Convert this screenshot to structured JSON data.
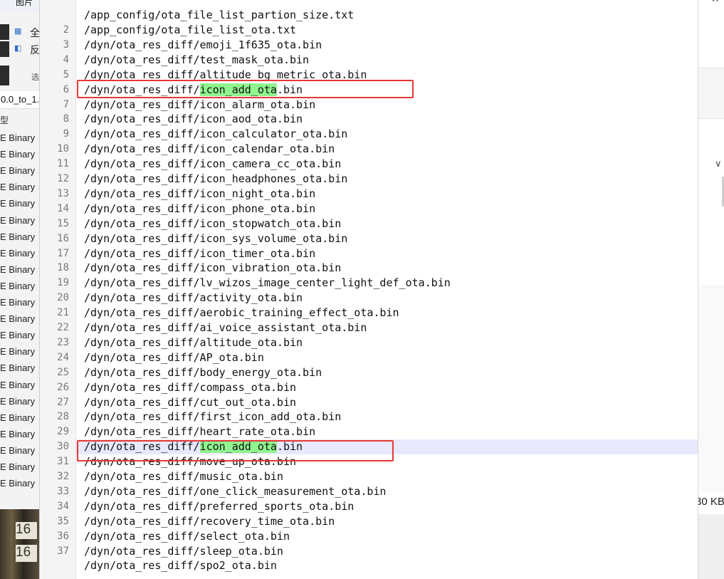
{
  "left_panel": {
    "title_fragment": "图片",
    "toolbar_items": [
      "全",
      "反"
    ],
    "nav_fragment": "选",
    "breadcrumb_fragment": "0.0_to_1.",
    "column_header_fragment": "型",
    "type_values": [
      "E Binary",
      "E Binary",
      "E Binary",
      "E Binary",
      "E Binary",
      "E Binary",
      "E Binary",
      "E Binary",
      "E Binary",
      "E Binary",
      "E Binary",
      "E Binary",
      "E Binary",
      "E Binary",
      "E Binary",
      "E Binary",
      "E Binary",
      "E Binary",
      "E Binary",
      "E Binary",
      "E Binary",
      "E Binary"
    ],
    "photo_numbers": [
      "16",
      "16"
    ]
  },
  "editor": {
    "first_line_fragment": "/app_config/ota_file_list_partion_size.txt",
    "lines": [
      {
        "n": "2",
        "text": "/app_config/ota_file_list_ota.txt"
      },
      {
        "n": "3",
        "text": "/dyn/ota_res_diff/emoji_1f635_ota.bin"
      },
      {
        "n": "4",
        "text": "/dyn/ota_res_diff/test_mask_ota.bin"
      },
      {
        "n": "5",
        "text": "/dyn/ota_res_diff/altitude_bg_metric_ota.bin"
      },
      {
        "n": "6",
        "pre": "/dyn/ota_res_diff/",
        "hl": "icon_add_ota",
        "post": ".bin"
      },
      {
        "n": "7",
        "text": "/dyn/ota_res_diff/icon_alarm_ota.bin"
      },
      {
        "n": "8",
        "text": "/dyn/ota_res_diff/icon_aod_ota.bin"
      },
      {
        "n": "9",
        "text": "/dyn/ota_res_diff/icon_calculator_ota.bin"
      },
      {
        "n": "10",
        "text": "/dyn/ota_res_diff/icon_calendar_ota.bin"
      },
      {
        "n": "11",
        "text": "/dyn/ota_res_diff/icon_camera_cc_ota.bin"
      },
      {
        "n": "12",
        "text": "/dyn/ota_res_diff/icon_headphones_ota.bin"
      },
      {
        "n": "13",
        "text": "/dyn/ota_res_diff/icon_night_ota.bin"
      },
      {
        "n": "14",
        "text": "/dyn/ota_res_diff/icon_phone_ota.bin"
      },
      {
        "n": "15",
        "text": "/dyn/ota_res_diff/icon_stopwatch_ota.bin"
      },
      {
        "n": "16",
        "text": "/dyn/ota_res_diff/icon_sys_volume_ota.bin"
      },
      {
        "n": "17",
        "text": "/dyn/ota_res_diff/icon_timer_ota.bin"
      },
      {
        "n": "18",
        "text": "/dyn/ota_res_diff/icon_vibration_ota.bin"
      },
      {
        "n": "19",
        "text": "/dyn/ota_res_diff/lv_wizos_image_center_light_def_ota.bin"
      },
      {
        "n": "20",
        "text": "/dyn/ota_res_diff/activity_ota.bin"
      },
      {
        "n": "21",
        "text": "/dyn/ota_res_diff/aerobic_training_effect_ota.bin"
      },
      {
        "n": "22",
        "text": "/dyn/ota_res_diff/ai_voice_assistant_ota.bin"
      },
      {
        "n": "23",
        "text": "/dyn/ota_res_diff/altitude_ota.bin"
      },
      {
        "n": "24",
        "text": "/dyn/ota_res_diff/AP_ota.bin"
      },
      {
        "n": "25",
        "text": "/dyn/ota_res_diff/body_energy_ota.bin"
      },
      {
        "n": "26",
        "text": "/dyn/ota_res_diff/compass_ota.bin"
      },
      {
        "n": "27",
        "text": "/dyn/ota_res_diff/cut_out_ota.bin"
      },
      {
        "n": "28",
        "text": "/dyn/ota_res_diff/first_icon_add_ota.bin"
      },
      {
        "n": "29",
        "text": "/dyn/ota_res_diff/heart_rate_ota.bin"
      },
      {
        "n": "30",
        "pre": "/dyn/ota_res_diff/",
        "hl": "icon_add_ota",
        "post": ".bin",
        "active": true
      },
      {
        "n": "31",
        "text": "/dyn/ota_res_diff/move_up_ota.bin"
      },
      {
        "n": "32",
        "text": "/dyn/ota_res_diff/music_ota.bin"
      },
      {
        "n": "33",
        "text": "/dyn/ota_res_diff/one_click_measurement_ota.bin"
      },
      {
        "n": "34",
        "text": "/dyn/ota_res_diff/preferred_sports_ota.bin"
      },
      {
        "n": "35",
        "text": "/dyn/ota_res_diff/recovery_time_ota.bin"
      },
      {
        "n": "36",
        "text": "/dyn/ota_res_diff/select_ota.bin"
      },
      {
        "n": "37",
        "text": "/dyn/ota_res_diff/sleep_ota.bin"
      }
    ],
    "last_line_fragment": "/dyn/ota_res_diff/spo2_ota.bin",
    "highlight_color": "#8ff58f",
    "box_color": "#e53935"
  },
  "right_panel": {
    "size_fragment": "30 KB",
    "chevron": "chevron-down-icon"
  }
}
